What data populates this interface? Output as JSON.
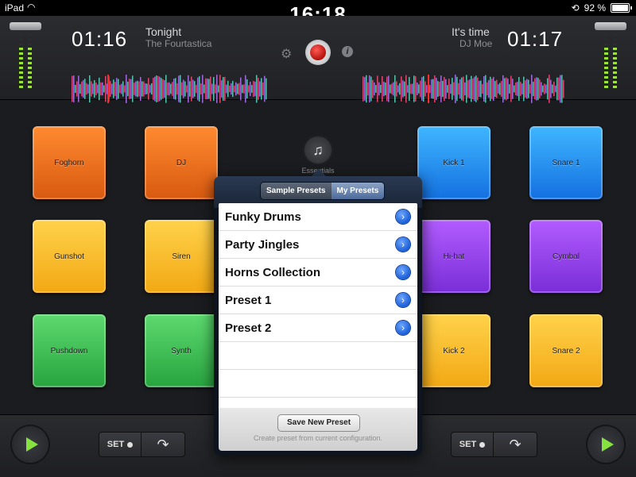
{
  "status": {
    "carrier": "iPad",
    "time": "16:18",
    "battery": "92 %"
  },
  "deck_left": {
    "time": "01:16",
    "title": "Tonight",
    "artist": "The Fourtastica"
  },
  "deck_right": {
    "time": "01:17",
    "title": "It's time",
    "artist": "DJ Moe"
  },
  "icons": {
    "settings": "gear-icon",
    "record": "record-icon",
    "info": "info-icon",
    "music": "music-note-add-icon"
  },
  "pads_left": [
    {
      "label": "Foghorn",
      "color": "orange"
    },
    {
      "label": "DJ",
      "color": "orange"
    },
    {
      "label": "Gunshot",
      "color": "yellow"
    },
    {
      "label": "Siren",
      "color": "yellow"
    },
    {
      "label": "Pushdown",
      "color": "green"
    },
    {
      "label": "Synth",
      "color": "green"
    }
  ],
  "pads_right": [
    {
      "label": "Kick 1",
      "color": "blue"
    },
    {
      "label": "Snare 1",
      "color": "blue"
    },
    {
      "label": "Hi-hat",
      "color": "purple"
    },
    {
      "label": "Cymbal",
      "color": "purple"
    },
    {
      "label": "Kick 2",
      "color": "yellow"
    },
    {
      "label": "Snare 2",
      "color": "yellow"
    }
  ],
  "popover": {
    "anchor_label": "Essentials",
    "tabs": [
      "Sample Presets",
      "My Presets"
    ],
    "active_tab": "My Presets",
    "items": [
      "Funky Drums",
      "Party Jingles",
      "Horns Collection",
      "Preset 1",
      "Preset 2"
    ],
    "save_label": "Save New Preset",
    "hint": "Create preset from current configuration."
  },
  "bottom": {
    "set_label": "SET"
  }
}
